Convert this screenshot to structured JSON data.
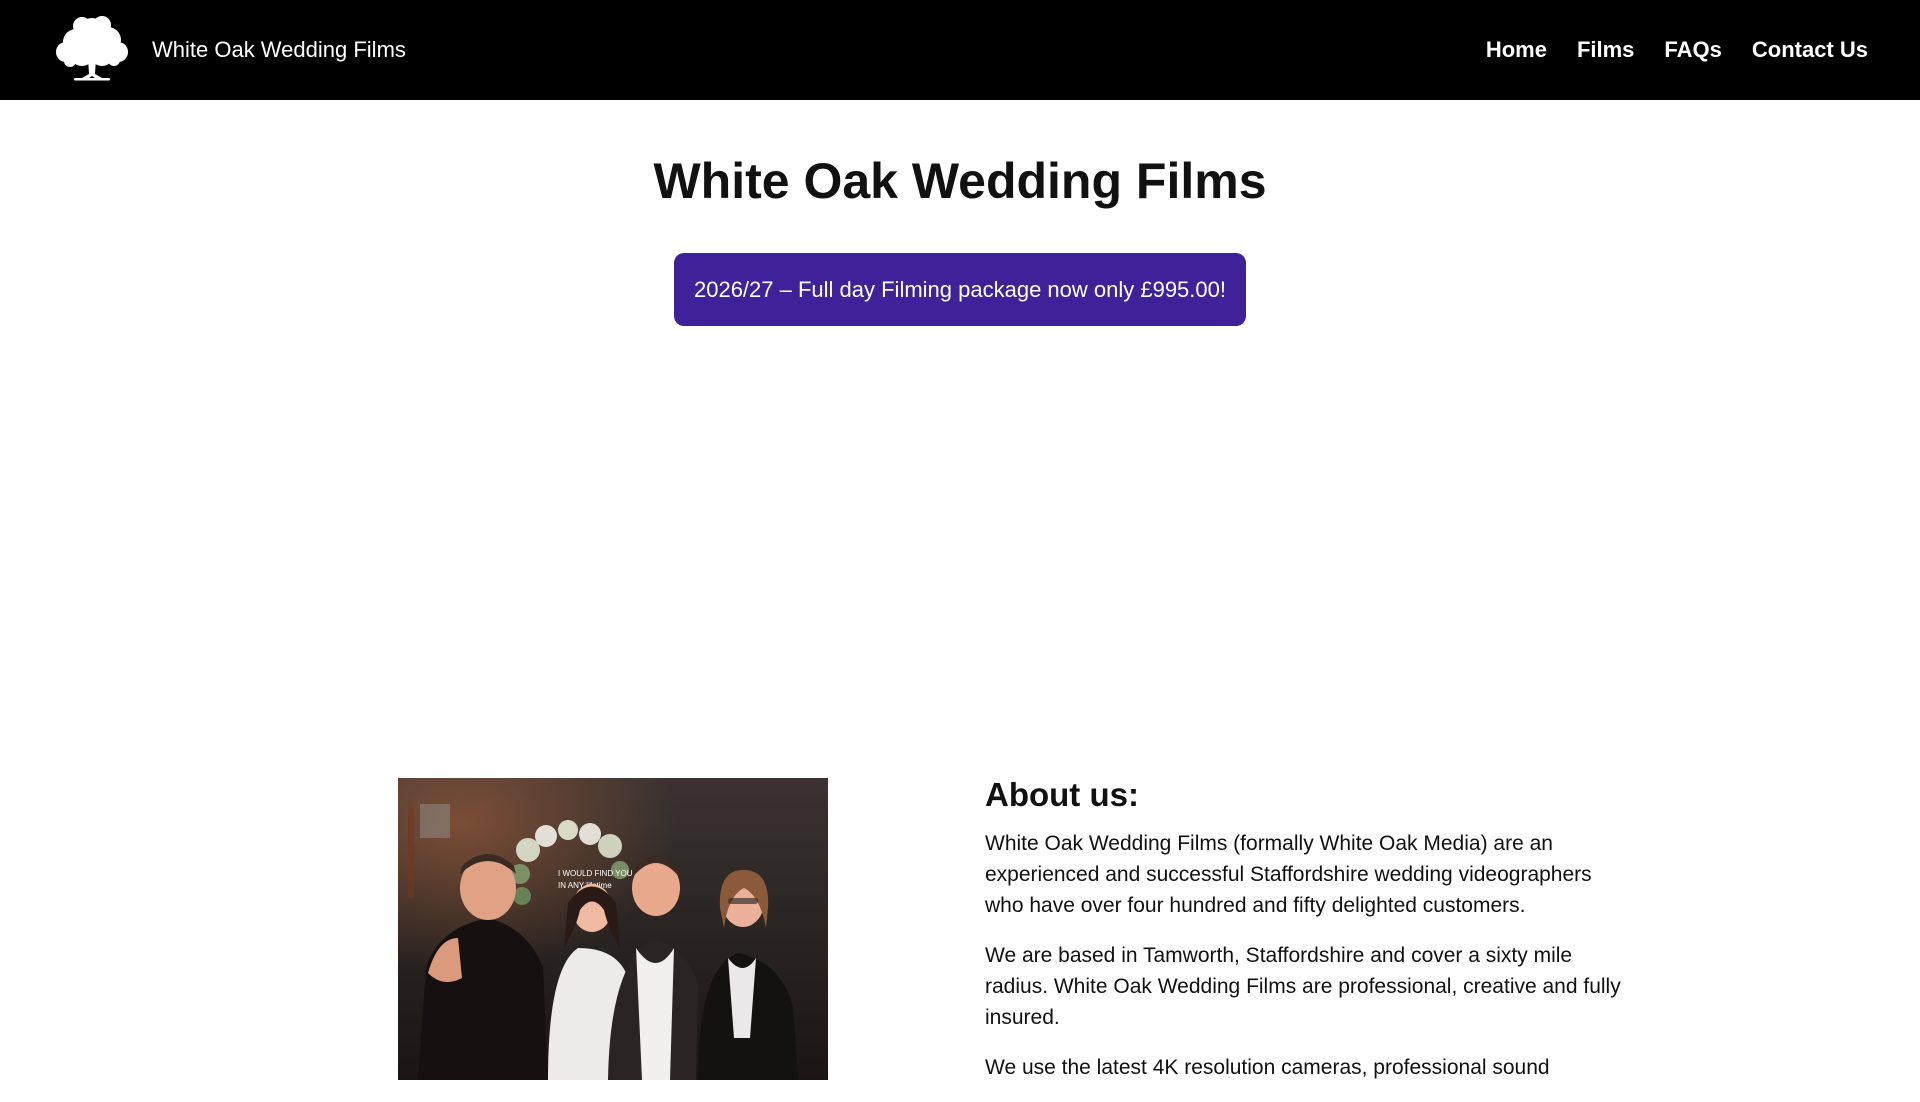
{
  "header": {
    "brand_name": "White Oak Wedding Films",
    "logo_icon": "oak-tree-icon",
    "nav": [
      {
        "label": "Home"
      },
      {
        "label": "Films"
      },
      {
        "label": "FAQs"
      },
      {
        "label": "Contact Us"
      }
    ],
    "background": "#000000"
  },
  "hero": {
    "title": "White Oak Wedding Films",
    "promo_label": "2026/27 – Full day Filming package now only £995.00!",
    "promo_color": "#3f2199"
  },
  "about": {
    "heading": "About us:",
    "paragraphs": [
      "White Oak Wedding Films (formally White Oak Media) are an experienced and successful Staffordshire wedding videographers who have over four hundred and fifty delighted customers.",
      "We are based in Tamworth, Staffordshire and cover a sixty mile radius. White Oak Wedding Films are professional, creative and fully insured.",
      "We use the latest 4K resolution cameras, professional sound"
    ],
    "photo": {
      "neon_sign_text": "I WOULD FIND YOU IN ANY lifetime"
    }
  }
}
